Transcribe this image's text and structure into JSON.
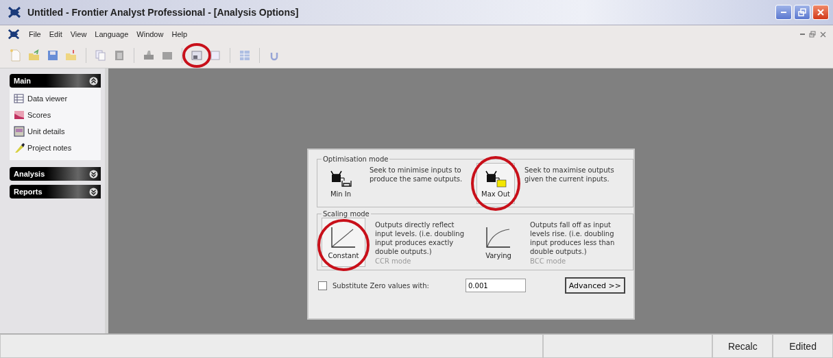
{
  "window": {
    "title": "Untitled - Frontier Analyst Professional - [Analysis Options]"
  },
  "menu": [
    "File",
    "Edit",
    "View",
    "Language",
    "Window",
    "Help"
  ],
  "sidebar": [
    {
      "title": "Main",
      "expanded": true,
      "items": [
        {
          "label": "Data viewer",
          "kind": "grid"
        },
        {
          "label": "Scores",
          "kind": "chart"
        },
        {
          "label": "Unit details",
          "kind": "form"
        },
        {
          "label": "Project notes",
          "kind": "pen"
        }
      ]
    },
    {
      "title": "Analysis",
      "expanded": false
    },
    {
      "title": "Reports",
      "expanded": false
    }
  ],
  "optimisation": {
    "legend": "Optimisation mode",
    "options": [
      {
        "label": "Min In",
        "kind": "min",
        "description": "Seek to minimise inputs to produce the same outputs.",
        "selected": false
      },
      {
        "label": "Max Out",
        "kind": "max",
        "description": "Seek to maximise outputs given the current inputs.",
        "selected": true
      }
    ]
  },
  "scaling": {
    "legend": "Scaling mode",
    "options": [
      {
        "label": "Constant",
        "kind": "linear",
        "description": "Outputs directly reflect input levels. (i.e. doubling input produces exactly double outputs.)",
        "note": "CCR mode",
        "selected": true
      },
      {
        "label": "Varying",
        "kind": "curve",
        "description": "Outputs fall off as input levels rise. (i.e. doubling input produces less than double outputs.)",
        "note": "BCC mode",
        "selected": false
      }
    ]
  },
  "substitute": {
    "label": "Substitute Zero values with:",
    "checked": false,
    "value": "0.001"
  },
  "advanced_button": "Advanced >>",
  "status_bar": [
    "Recalc",
    "Edited"
  ]
}
